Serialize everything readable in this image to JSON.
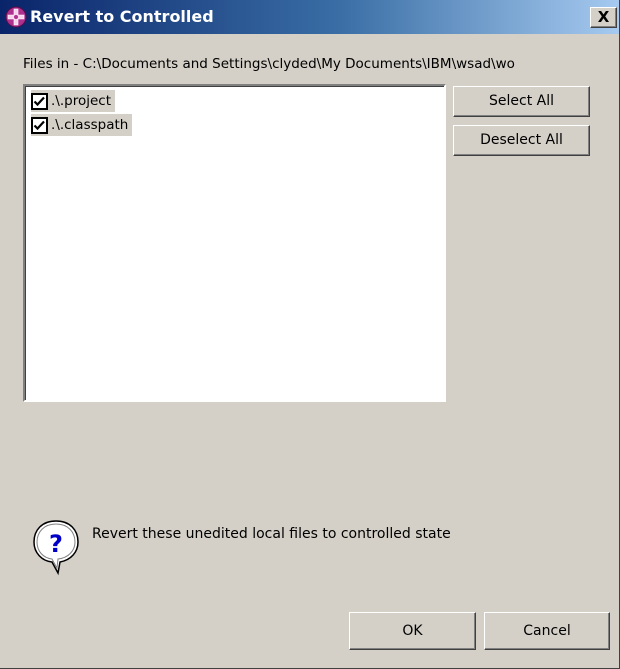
{
  "window": {
    "title": "Revert to Controlled",
    "close_label": "X",
    "title_icon": "eclipse-cross-icon"
  },
  "path": {
    "label": "Files in - C:\\Documents and Settings\\clyded\\My Documents\\IBM\\wsad\\wo"
  },
  "files": [
    {
      "label": ".\\.project",
      "checked": true
    },
    {
      "label": ".\\.classpath",
      "checked": true
    }
  ],
  "side_buttons": {
    "select_all": "Select All",
    "deselect_all": "Deselect All"
  },
  "message": {
    "icon": "question-icon",
    "text": "Revert these unedited local files to controlled state"
  },
  "footer": {
    "ok": "OK",
    "cancel": "Cancel"
  },
  "colors": {
    "dialog_bg": "#d4d0c8",
    "titlebar_start": "#0a246a",
    "titlebar_end": "#a6caf0",
    "icon_magenta": "#b0308f"
  }
}
